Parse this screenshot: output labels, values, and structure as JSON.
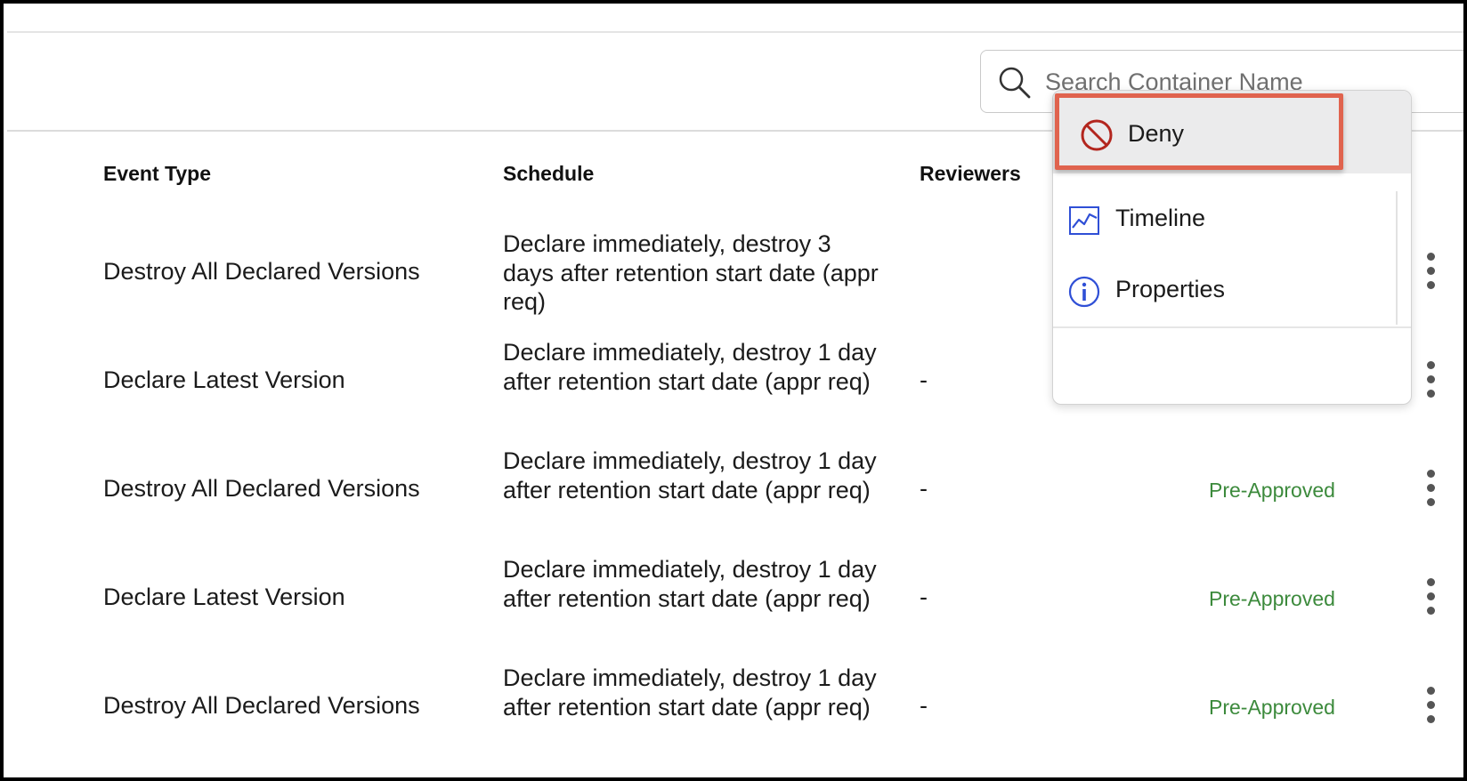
{
  "search": {
    "placeholder": "Search Container Name"
  },
  "table": {
    "columns": {
      "event_type": "Event Type",
      "schedule": "Schedule",
      "reviewers": "Reviewers"
    },
    "rows": [
      {
        "event_type": "Destroy All Declared Versions",
        "schedule": "Declare immediately, destroy 3 days after retention start date (appr req)",
        "reviewers": "",
        "status": ""
      },
      {
        "event_type": "Declare Latest Version",
        "schedule": "Declare immediately, destroy 1 day after retention start date (appr req)",
        "reviewers": "-",
        "status": ""
      },
      {
        "event_type": "Destroy All Declared Versions",
        "schedule": "Declare immediately, destroy 1 day after retention start date (appr req)",
        "reviewers": "-",
        "status": "Pre-Approved"
      },
      {
        "event_type": "Declare Latest Version",
        "schedule": "Declare immediately, destroy 1 day after retention start date (appr req)",
        "reviewers": "-",
        "status": "Pre-Approved"
      },
      {
        "event_type": "Destroy All Declared Versions",
        "schedule": "Declare immediately, destroy 1 day after retention start date (appr req)",
        "reviewers": "-",
        "status": "Pre-Approved"
      }
    ]
  },
  "context_menu": {
    "items": [
      {
        "label": "Deny",
        "icon": "deny-icon"
      },
      {
        "label": "Timeline",
        "icon": "timeline-chart-icon"
      },
      {
        "label": "Properties",
        "icon": "info-icon"
      }
    ]
  },
  "colors": {
    "status_green": "#3c8a3c",
    "highlight_border": "#e0634e",
    "deny_red": "#b3261e",
    "icon_blue": "#2f4fd6"
  }
}
